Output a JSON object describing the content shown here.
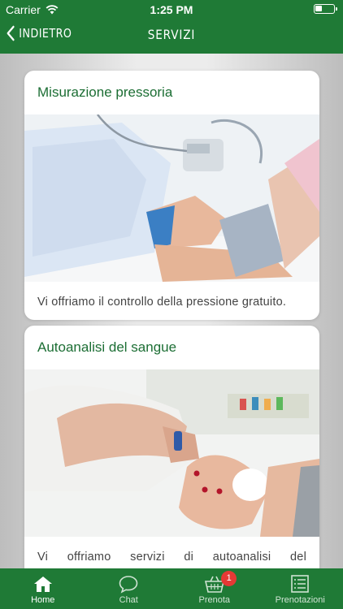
{
  "status_bar": {
    "carrier": "Carrier",
    "time": "1:25 PM"
  },
  "nav": {
    "back_label": "INDIETRO",
    "title": "SERVIZI"
  },
  "cards": [
    {
      "title": "Misurazione pressoria",
      "text": "Vi offriamo il controllo della pressione gratuito."
    },
    {
      "title": "Autoanalisi del sangue",
      "text": "Vi offriamo servizi di autoanalisi del"
    }
  ],
  "tabbar": {
    "tabs": [
      {
        "label": "Home",
        "icon": "home-icon"
      },
      {
        "label": "Chat",
        "icon": "chat-icon"
      },
      {
        "label": "Prenota",
        "icon": "basket-icon",
        "badge": "1"
      },
      {
        "label": "Prenotazioni",
        "icon": "list-icon"
      }
    ]
  },
  "colors": {
    "brand_green": "#1f7a36",
    "title_green": "#1c6e34",
    "badge_red": "#e53935"
  }
}
